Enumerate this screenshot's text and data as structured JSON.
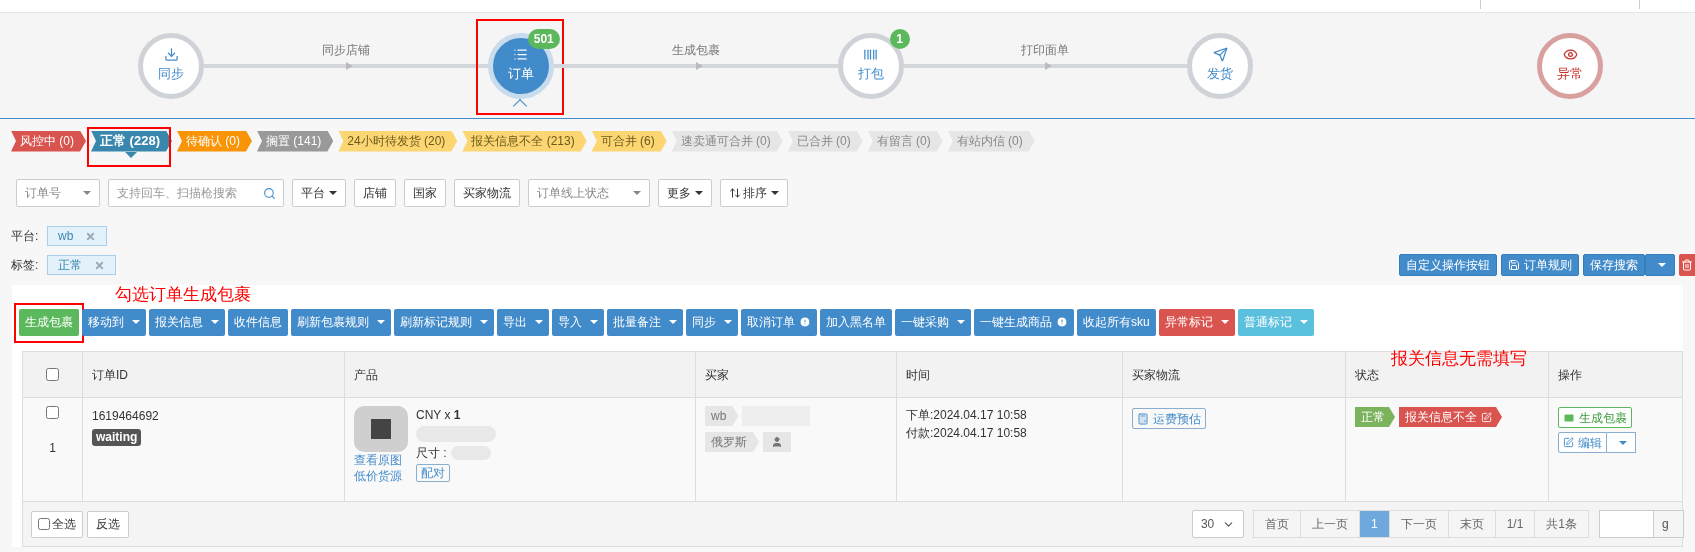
{
  "workflow": {
    "steps": [
      {
        "label": "同步",
        "selected": false,
        "kind": "normal"
      },
      {
        "label": "订单",
        "badge": "501",
        "selected": true,
        "kind": "normal"
      },
      {
        "label": "打包",
        "badge": "1",
        "selected": false,
        "kind": "normal"
      },
      {
        "label": "发货",
        "selected": false,
        "kind": "normal"
      },
      {
        "label": "异常",
        "selected": false,
        "kind": "alert"
      }
    ],
    "connectors": [
      "同步店铺",
      "生成包裹",
      "打印面单"
    ]
  },
  "status_tabs": [
    {
      "label": "风控中 (0)",
      "color": "#d9534f",
      "selected": false
    },
    {
      "label": "正常 (228)",
      "color": "#3a87ad",
      "selected": true
    },
    {
      "label": "待确认 (0)",
      "color": "#f89406",
      "selected": false
    },
    {
      "label": "搁置 (141)",
      "color": "#999999",
      "selected": false
    },
    {
      "label": "24小时待发货 (20)",
      "color": "#fcd672",
      "selected": false
    },
    {
      "label": "报关信息不全 (213)",
      "color": "#fcd672",
      "selected": false
    },
    {
      "label": "可合并 (6)",
      "color": "#fcd672",
      "selected": false
    },
    {
      "label": "速卖通可合并 (0)",
      "color": "#e6e6e6",
      "selected": false
    },
    {
      "label": "已合并 (0)",
      "color": "#e6e6e6",
      "selected": false
    },
    {
      "label": "有留言 (0)",
      "color": "#e6e6e6",
      "selected": false
    },
    {
      "label": "有站内信 (0)",
      "color": "#e6e6e6",
      "selected": false
    }
  ],
  "filters": [
    {
      "kind": "select",
      "label": "订单号"
    },
    {
      "kind": "search",
      "placeholder": "支持回车、扫描枪搜索"
    },
    {
      "kind": "dropdown",
      "label": "平台"
    },
    {
      "kind": "button",
      "label": "店铺"
    },
    {
      "kind": "button",
      "label": "国家"
    },
    {
      "kind": "button",
      "label": "买家物流"
    },
    {
      "kind": "select",
      "label": "订单线上状态"
    },
    {
      "kind": "dropdown",
      "label": "更多"
    },
    {
      "kind": "sort",
      "label": "排序"
    }
  ],
  "active_filters": [
    {
      "label": "平台:",
      "value": "wb"
    },
    {
      "label": "标签:",
      "value": "正常"
    }
  ],
  "right_buttons": [
    {
      "kind": "plain",
      "label": "自定义操作按钮"
    },
    {
      "kind": "save",
      "label": "订单规则"
    },
    {
      "kind": "split",
      "label": "保存搜索"
    },
    {
      "kind": "trash"
    }
  ],
  "toolbar": [
    {
      "label": "生成包裹",
      "color": "#5cb85c",
      "dropdown": false,
      "alert": false
    },
    {
      "label": "移动到",
      "color": "#428bca",
      "dropdown": true,
      "alert": false
    },
    {
      "label": "报关信息",
      "color": "#428bca",
      "dropdown": true,
      "alert": false
    },
    {
      "label": "收件信息",
      "color": "#428bca",
      "dropdown": false,
      "alert": false
    },
    {
      "label": "刷新包裹规则",
      "color": "#428bca",
      "dropdown": true,
      "alert": false
    },
    {
      "label": "刷新标记规则",
      "color": "#428bca",
      "dropdown": true,
      "alert": false
    },
    {
      "label": "导出",
      "color": "#428bca",
      "dropdown": true,
      "alert": false
    },
    {
      "label": "导入",
      "color": "#428bca",
      "dropdown": true,
      "alert": false
    },
    {
      "label": "批量备注",
      "color": "#428bca",
      "dropdown": true,
      "alert": false
    },
    {
      "label": "同步",
      "color": "#428bca",
      "dropdown": true,
      "alert": false
    },
    {
      "label": "取消订单",
      "color": "#428bca",
      "dropdown": false,
      "alert": true
    },
    {
      "label": "加入黑名单",
      "color": "#428bca",
      "dropdown": false,
      "alert": false
    },
    {
      "label": "一键采购",
      "color": "#428bca",
      "dropdown": true,
      "alert": false
    },
    {
      "label": "一键生成商品",
      "color": "#428bca",
      "dropdown": false,
      "alert": true
    },
    {
      "label": "收起所有sku",
      "color": "#428bca",
      "dropdown": false,
      "alert": false
    },
    {
      "label": "异常标记",
      "color": "#d9534f",
      "dropdown": true,
      "alert": false
    },
    {
      "label": "普通标记",
      "color": "#5bc0de",
      "dropdown": true,
      "alert": false
    }
  ],
  "table": {
    "header_checked": false,
    "columns": [
      "订单ID",
      "产品",
      "买家",
      "时间",
      "买家物流",
      "状态",
      "操作"
    ],
    "rows": [
      {
        "checked": false,
        "index": "1",
        "order_id": "1619464692",
        "order_status": "waiting",
        "product": {
          "price": "CNY x **1**",
          "size_label": "尺寸 :",
          "links": [
            "查看原图",
            "低价货源"
          ],
          "pair_button": "配对"
        },
        "buyer": {
          "platform": "wb",
          "country": "俄罗斯"
        },
        "time": [
          "下单:2024.04.17 10:58",
          "付款:2024.04.17 10:58"
        ],
        "logistics_button": "运费预估",
        "statuses": [
          {
            "label": "正常",
            "color": "#7cb35d"
          },
          {
            "label": "报关信息不全",
            "color": "#d9534f"
          }
        ],
        "actions": {
          "primary": "生成包裹",
          "edit": "编辑"
        }
      }
    ]
  },
  "footer": {
    "select_all": "全选",
    "select_all_checked": false,
    "invert": "反选",
    "page_size": "30",
    "pages": [
      {
        "label": "首页",
        "selected": false
      },
      {
        "label": "上一页",
        "selected": false
      },
      {
        "label": "1",
        "selected": true
      },
      {
        "label": "下一页",
        "selected": false
      },
      {
        "label": "末页",
        "selected": false
      },
      {
        "label": "1/1",
        "selected": false
      },
      {
        "label": "共1条",
        "selected": false
      }
    ],
    "go": "g"
  },
  "annotations": [
    "勾选订单生成包裹",
    "报关信息无需填写"
  ]
}
